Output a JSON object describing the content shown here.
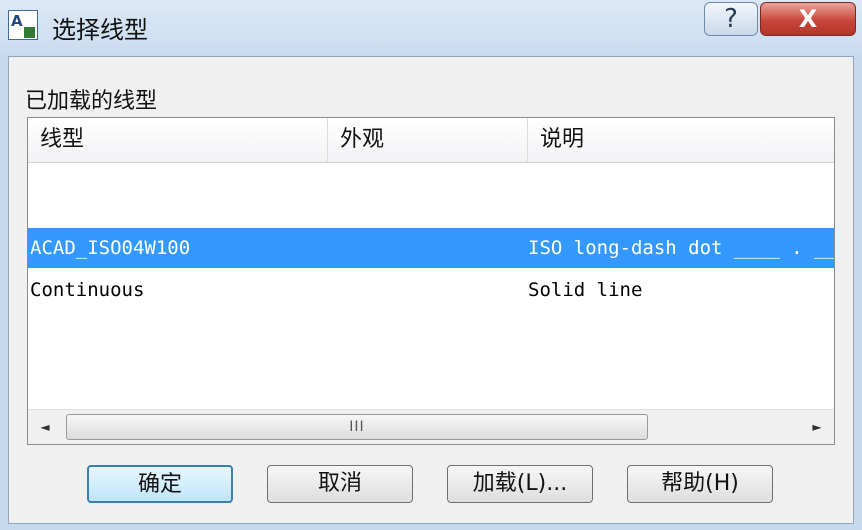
{
  "titlebar": {
    "title": "选择线型",
    "help_symbol": "?",
    "close_symbol": "X"
  },
  "section": {
    "label": "已加载的线型"
  },
  "list": {
    "columns": [
      "线型",
      "外观",
      "说明"
    ],
    "rows": [
      {
        "name": "ACAD_ISO04W100",
        "appearance": "long-dash-dot",
        "description": "ISO long-dash dot ____ . ____ . ____ . ____ . ",
        "selected": true
      },
      {
        "name": "Continuous",
        "appearance": "solid",
        "description": "Solid line",
        "selected": false
      }
    ],
    "scroll": {
      "left_arrow": "◄",
      "right_arrow": "►",
      "thumb_grip": "III"
    }
  },
  "buttons": {
    "ok": "确定",
    "cancel": "取消",
    "load": "加载(L)...",
    "help": "帮助(H)"
  },
  "colors": {
    "selection": "#3399ff",
    "close_button": "#c8463a"
  }
}
